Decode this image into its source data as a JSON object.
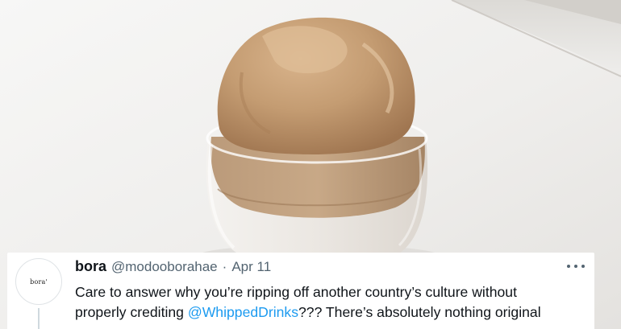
{
  "tweet": {
    "avatar_text": "bora'",
    "display_name": "bora",
    "handle": "@modooborahae",
    "separator": "·",
    "date": "Apr 11",
    "line1": "Care to answer why you’re ripping off another country’s culture without",
    "line2_prefix": "properly crediting ",
    "mention": "@WhippedDrinks",
    "line2_suffix": "??? There’s absolutely nothing original"
  },
  "icons": {
    "more": "more-horizontal-icon"
  },
  "colors": {
    "mention": "#1d9bf0",
    "secondary_text": "#536471",
    "primary_text": "#0f1419",
    "card_background": "#ffffff",
    "coffee_foam": "#c49c72",
    "milk": "#eeeae5"
  }
}
